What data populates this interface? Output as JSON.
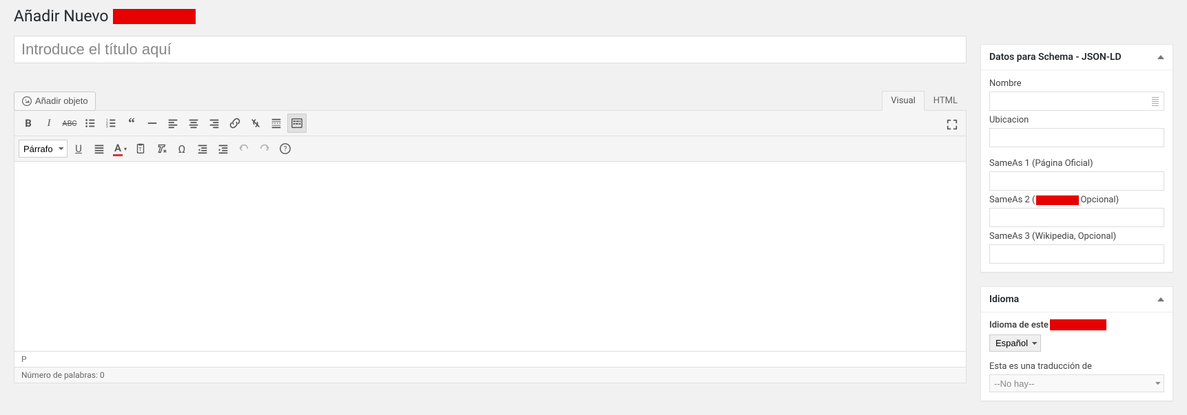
{
  "page": {
    "heading": "Añadir Nuevo"
  },
  "title_input": {
    "placeholder": "Introduce el título aquí"
  },
  "media_button": {
    "label": "Añadir objeto"
  },
  "editor_tabs": {
    "visual": "Visual",
    "html": "HTML"
  },
  "format_dropdown": {
    "selected": "Párrafo"
  },
  "status": {
    "path": "P",
    "wordcount": "Número de palabras: 0"
  },
  "sidebar": {
    "schema_box": {
      "title": "Datos para Schema - JSON-LD",
      "fields": {
        "nombre": "Nombre",
        "ubicacion": "Ubicacion",
        "sameas1": "SameAs 1 (Página Oficial)",
        "sameas2_pre": "SameAs 2 (",
        "sameas2_post": "Opcional)",
        "sameas3": "SameAs 3 (Wikipedia, Opcional)"
      }
    },
    "idioma_box": {
      "title": "Idioma",
      "label_prefix": "Idioma de este",
      "lang_selected": "Español",
      "translation_label": "Esta es una traducción de",
      "translation_selected": "--No hay--"
    }
  }
}
